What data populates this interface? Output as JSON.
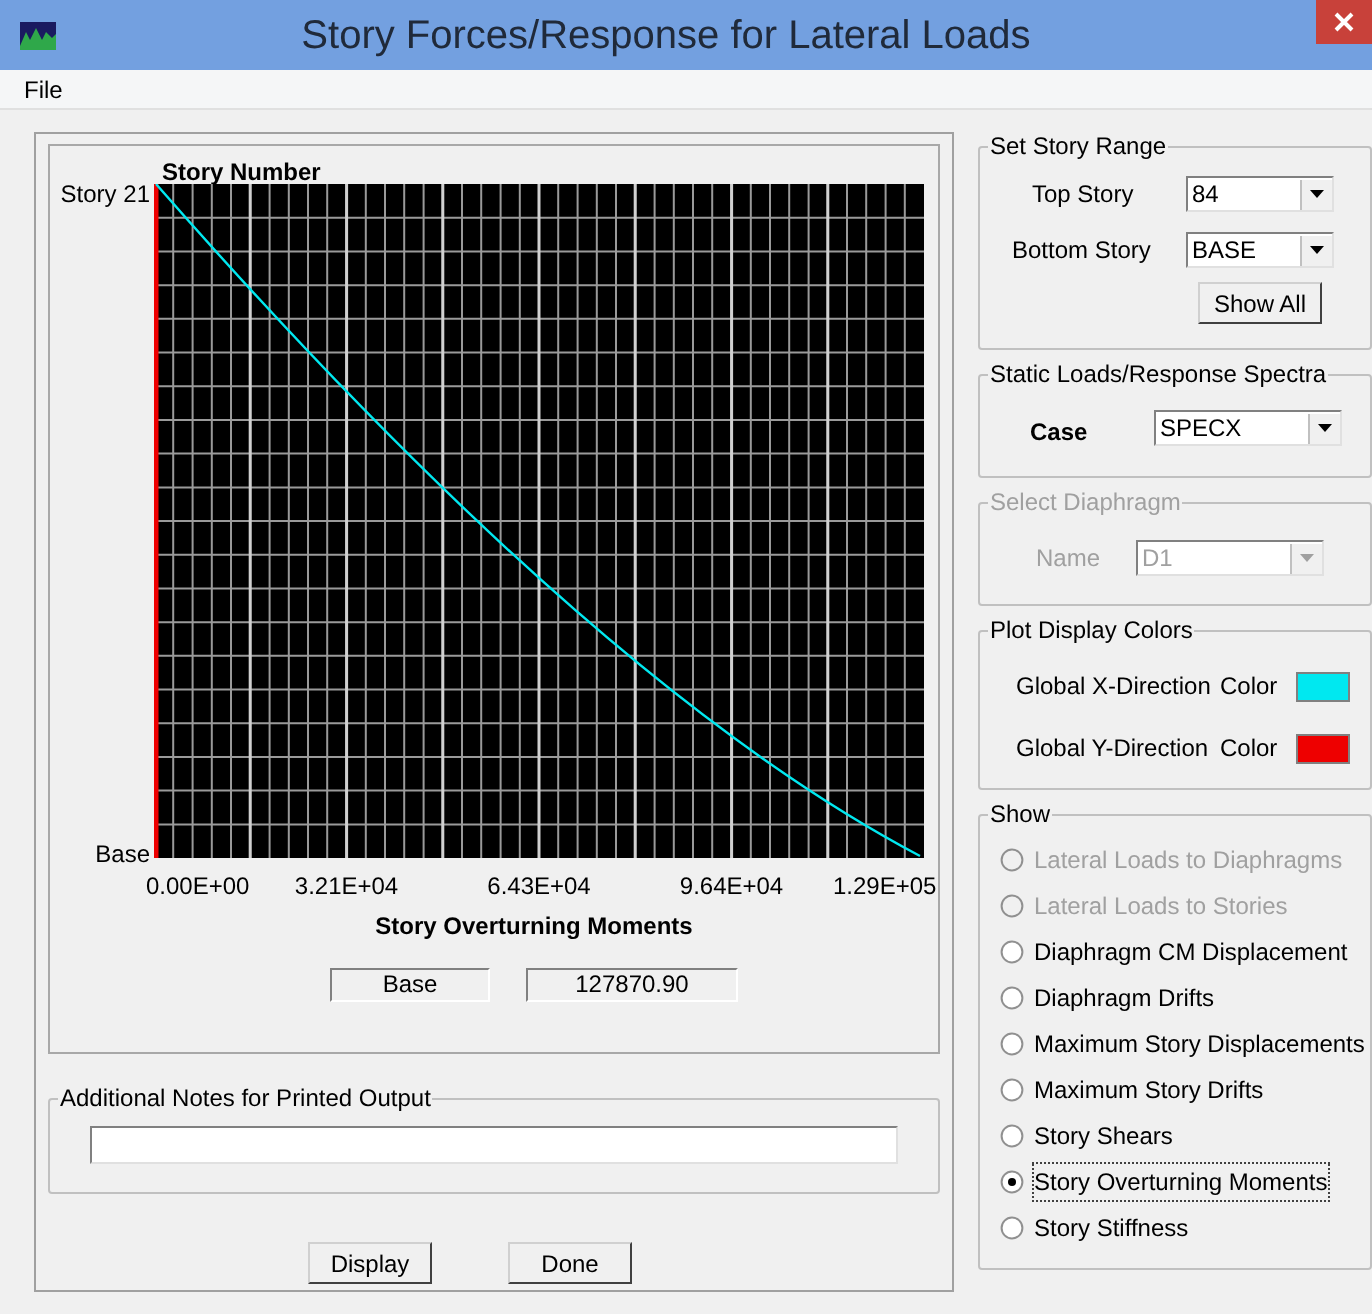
{
  "window": {
    "title": "Story Forces/Response for Lateral Loads"
  },
  "menu": [
    "File"
  ],
  "plot": {
    "ylabel": "Story Number",
    "y_top": "Story 21",
    "y_bottom": "Base",
    "x_ticks": [
      "0.00E+00",
      "3.21E+04",
      "6.43E+04",
      "9.64E+04",
      "1.29E+05"
    ],
    "xlabel": "Story Overturning Moments",
    "readout_story": "Base",
    "readout_value": "127870.90"
  },
  "notes": {
    "label": "Additional Notes for Printed Output"
  },
  "buttons": [
    "Display",
    "Done"
  ],
  "story_range": {
    "title": "Set Story Range",
    "top_label": "Top Story",
    "top_value": "84",
    "bottom_label": "Bottom Story",
    "bottom_value": "BASE",
    "show_all": "Show All"
  },
  "loads": {
    "title": "Static Loads/Response Spectra",
    "case_label": "Case",
    "case_value": "SPECX"
  },
  "diaphragm": {
    "title": "Select  Diaphragm",
    "name_label": "Name",
    "name_value": "D1",
    "disabled": true
  },
  "colors": {
    "title": "Plot Display Colors",
    "items": [
      {
        "label": "Global X-Direction",
        "color_label": "Color",
        "color": "#00e8f0"
      },
      {
        "label": "Global Y-Direction",
        "color_label": "Color",
        "color": "#ee0000"
      }
    ]
  },
  "show": {
    "title": "Show",
    "options": [
      {
        "label": "Lateral Loads to Diaphragms",
        "disabled": true,
        "selected": false
      },
      {
        "label": "Lateral Loads to Stories",
        "disabled": true,
        "selected": false
      },
      {
        "label": "Diaphragm CM Displacement",
        "disabled": false,
        "selected": false
      },
      {
        "label": "Diaphragm Drifts",
        "disabled": false,
        "selected": false
      },
      {
        "label": "Maximum Story Displacements",
        "disabled": false,
        "selected": false
      },
      {
        "label": "Maximum Story Drifts",
        "disabled": false,
        "selected": false
      },
      {
        "label": "Story Shears",
        "disabled": false,
        "selected": false
      },
      {
        "label": "Story Overturning Moments",
        "disabled": false,
        "selected": true
      },
      {
        "label": "Story Stiffness",
        "disabled": false,
        "selected": false
      }
    ]
  }
}
